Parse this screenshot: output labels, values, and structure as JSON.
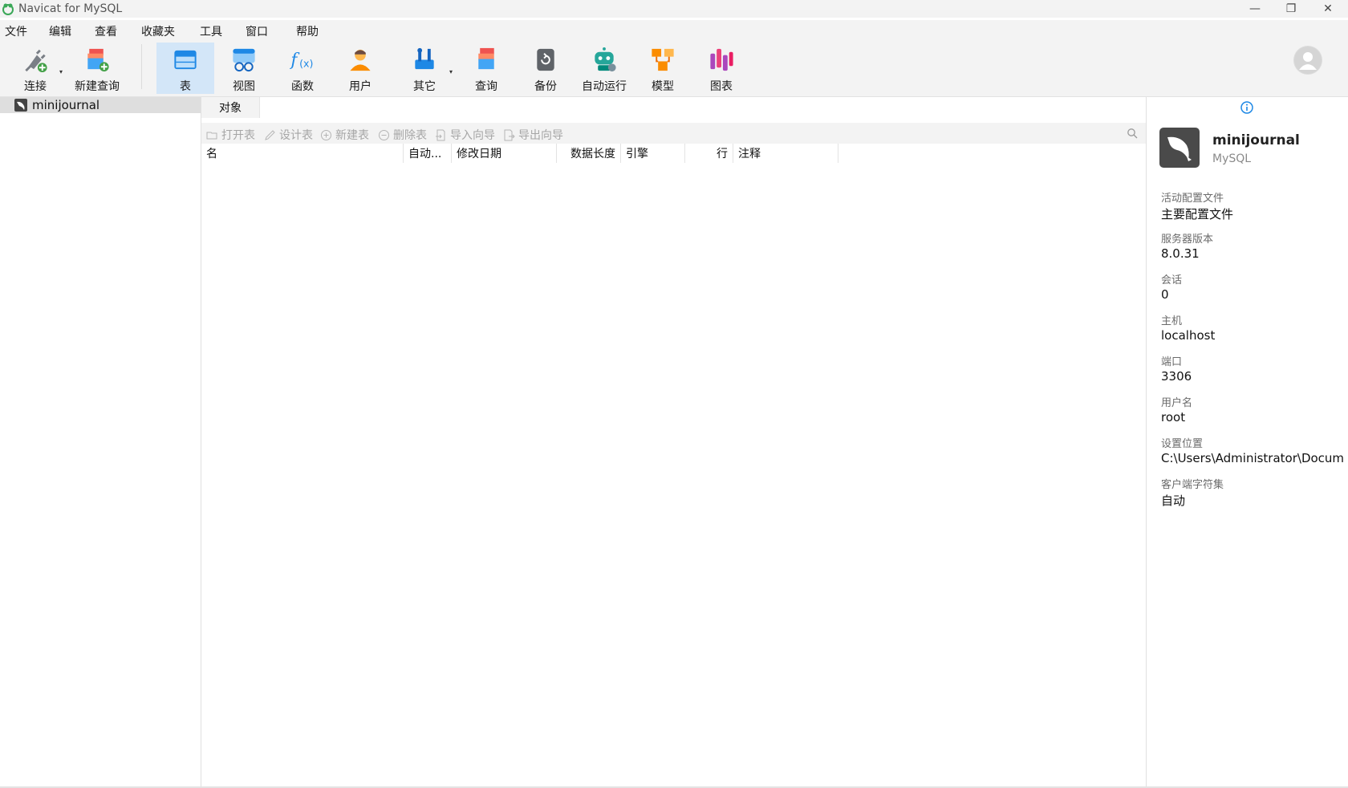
{
  "window": {
    "title": "Navicat for MySQL",
    "min_glyph": "—",
    "max_glyph": "❐",
    "close_glyph": "✕"
  },
  "menu": [
    "文件",
    "编辑",
    "查看",
    "收藏夹",
    "工具",
    "窗口",
    "帮助"
  ],
  "toolbar": {
    "connect": "连接",
    "new_query": "新建查询",
    "table": "表",
    "view": "视图",
    "function": "函数",
    "user": "用户",
    "other": "其它",
    "query": "查询",
    "backup": "备份",
    "automation": "自动运行",
    "model": "模型",
    "chart": "图表",
    "caret": "▾"
  },
  "nav": {
    "connection": "minijournal"
  },
  "main": {
    "tab": "对象",
    "actions": {
      "open_table": "打开表",
      "design_table": "设计表",
      "new_table": "新建表",
      "delete_table": "删除表",
      "import_wizard": "导入向导",
      "export_wizard": "导出向导"
    },
    "columns": {
      "name": "名",
      "auto": "自动...",
      "modified": "修改日期",
      "data_length": "数据长度",
      "engine": "引擎",
      "rows": "行",
      "comment": "注释"
    }
  },
  "info": {
    "name": "minijournal",
    "type": "MySQL",
    "properties": [
      {
        "label": "活动配置文件",
        "value": "主要配置文件"
      },
      {
        "label": "服务器版本",
        "value": "8.0.31"
      },
      {
        "label": "会话",
        "value": "0"
      },
      {
        "label": "主机",
        "value": "localhost"
      },
      {
        "label": "端口",
        "value": "3306"
      },
      {
        "label": "用户名",
        "value": "root"
      },
      {
        "label": "设置位置",
        "value": "C:\\Users\\Administrator\\Docum"
      },
      {
        "label": "客户端字符集",
        "value": "自动"
      }
    ]
  },
  "colors": {
    "chrome": "#f3f3f3",
    "active_tool": "#d3e6f8",
    "accent_blue": "#1e88e5",
    "disabled_text": "#a6a6a6"
  }
}
